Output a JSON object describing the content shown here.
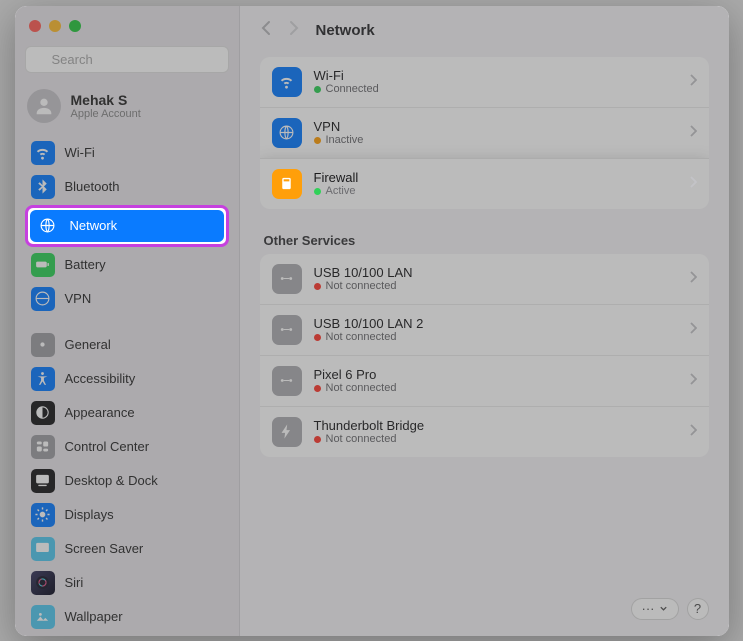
{
  "sidebar": {
    "search_placeholder": "Search",
    "account": {
      "name": "Mehak S",
      "subtitle": "Apple Account"
    },
    "groups": [
      [
        {
          "id": "wifi",
          "label": "Wi-Fi",
          "color": "#0a7bff"
        },
        {
          "id": "bluetooth",
          "label": "Bluetooth",
          "color": "#0a7bff"
        },
        {
          "id": "network",
          "label": "Network",
          "color": "#0a7bff",
          "selected": true,
          "highlighted": true
        },
        {
          "id": "battery",
          "label": "Battery",
          "color": "#30d158"
        },
        {
          "id": "vpn",
          "label": "VPN",
          "color": "#0a7bff"
        }
      ],
      [
        {
          "id": "general",
          "label": "General",
          "color": "#9e9ea4"
        },
        {
          "id": "accessibility",
          "label": "Accessibility",
          "color": "#0a7bff"
        },
        {
          "id": "appearance",
          "label": "Appearance",
          "color": "#1c1c1e"
        },
        {
          "id": "control-center",
          "label": "Control Center",
          "color": "#9e9ea4"
        },
        {
          "id": "desktop-dock",
          "label": "Desktop & Dock",
          "color": "#1c1c1e"
        },
        {
          "id": "displays",
          "label": "Displays",
          "color": "#0a7bff"
        },
        {
          "id": "screen-saver",
          "label": "Screen Saver",
          "color": "#54c8ef"
        },
        {
          "id": "siri",
          "label": "Siri",
          "color": "gradient"
        },
        {
          "id": "wallpaper",
          "label": "Wallpaper",
          "color": "#54c8ef"
        }
      ]
    ]
  },
  "header": {
    "title": "Network"
  },
  "network": {
    "main_services": [
      {
        "id": "wifi",
        "title": "Wi-Fi",
        "status": "Connected",
        "status_color": "green",
        "icon_bg": "#0a7bff"
      },
      {
        "id": "vpn",
        "title": "VPN",
        "status": "Inactive",
        "status_color": "orange",
        "icon_bg": "#0a7bff"
      },
      {
        "id": "firewall",
        "title": "Firewall",
        "status": "Active",
        "status_color": "green",
        "icon_bg": "#ff9f0a",
        "highlighted": true
      }
    ],
    "other_label": "Other Services",
    "other_services": [
      {
        "id": "usb1",
        "title": "USB 10/100 LAN",
        "status": "Not connected",
        "status_color": "red"
      },
      {
        "id": "usb2",
        "title": "USB 10/100 LAN 2",
        "status": "Not connected",
        "status_color": "red"
      },
      {
        "id": "pixel",
        "title": "Pixel 6 Pro",
        "status": "Not connected",
        "status_color": "red"
      },
      {
        "id": "thunderbolt",
        "title": "Thunderbolt Bridge",
        "status": "Not connected",
        "status_color": "red"
      }
    ]
  },
  "footer": {
    "more": "···",
    "help": "?"
  }
}
